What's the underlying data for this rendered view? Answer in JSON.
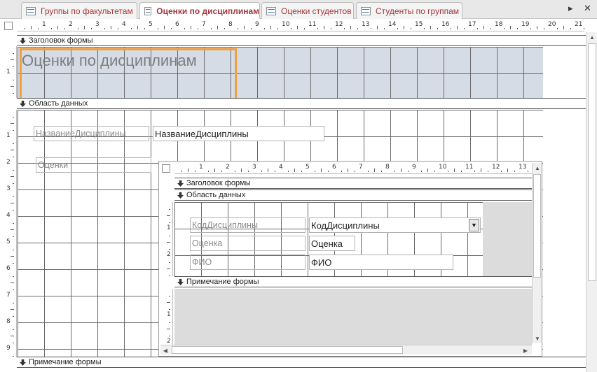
{
  "tabs": [
    {
      "label": "Группы по факультетам",
      "active": false
    },
    {
      "label": "Оценки по дисциплинам",
      "active": true
    },
    {
      "label": "Оценки студентов",
      "active": false
    },
    {
      "label": "Студенты по группам",
      "active": false
    }
  ],
  "tab_controls": {
    "scroll": "▸",
    "close": "✕"
  },
  "ruler_numbers": [
    "1",
    "2",
    "3",
    "4",
    "5",
    "6",
    "7",
    "8",
    "9",
    "10",
    "11",
    "12",
    "13",
    "14",
    "15",
    "16",
    "17",
    "18",
    "19",
    "20",
    "21"
  ],
  "subruler_numbers": [
    "1",
    "2",
    "3",
    "4",
    "5",
    "6",
    "7",
    "8",
    "9",
    "10",
    "11",
    "12",
    "13"
  ],
  "vruler_main": [
    "1",
    "2",
    "3",
    "4",
    "5",
    "6",
    "7",
    "8",
    "9"
  ],
  "vruler_header": [
    "1"
  ],
  "vruler_sub": [
    "1",
    "2"
  ],
  "vruler_sub_footer": [
    "1",
    "2"
  ],
  "main_form": {
    "header_section": "Заголовок формы",
    "title": "Оценки по дисциплинам",
    "detail_section": "Область данных",
    "discipline_label": "НазваниеДисциплины",
    "discipline_field": "НазваниеДисциплины",
    "grades_label": "Оценки",
    "footer_section": "Примечание формы"
  },
  "subform": {
    "header_section": "Заголовок формы",
    "detail_section": "Область данных",
    "code_label": "КодДисциплины",
    "code_field": "КодДисциплины",
    "grade_label": "Оценка",
    "grade_field": "Оценка",
    "fio_label": "ФИО",
    "fio_field": "ФИО",
    "footer_section": "Примечание формы"
  },
  "colors": {
    "tab_text": "#a4373a",
    "selection": "#f0a040",
    "header_fill": "#d6dce6"
  }
}
